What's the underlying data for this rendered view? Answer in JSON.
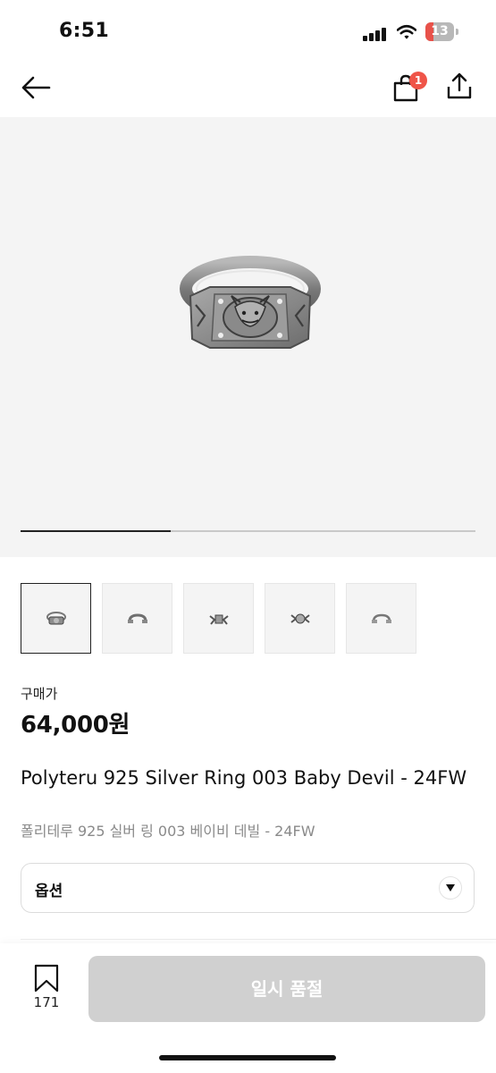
{
  "status_bar": {
    "time": "6:51",
    "battery": "13"
  },
  "header": {
    "cart_badge": "1",
    "icons": [
      "back-arrow-icon",
      "shopping-bag-icon",
      "share-icon"
    ]
  },
  "gallery": {
    "image_count": 5,
    "active_index": 0,
    "progress_fraction": 0.33
  },
  "product": {
    "price_label": "구매가",
    "price": "64,000원",
    "title": "Polyteru 925 Silver Ring 003 Baby Devil - 24FW",
    "subtitle": "폴리테루 925 실버 링 003 베이비 데빌 - 24FW"
  },
  "option": {
    "label": "옵션"
  },
  "bottom_bar": {
    "wish_count": "171",
    "button_label": "일시 품절"
  },
  "colors": {
    "badge": "#ef5448",
    "disabled_button": "#d0d0d0",
    "hero_bg": "#f4f4f4"
  }
}
